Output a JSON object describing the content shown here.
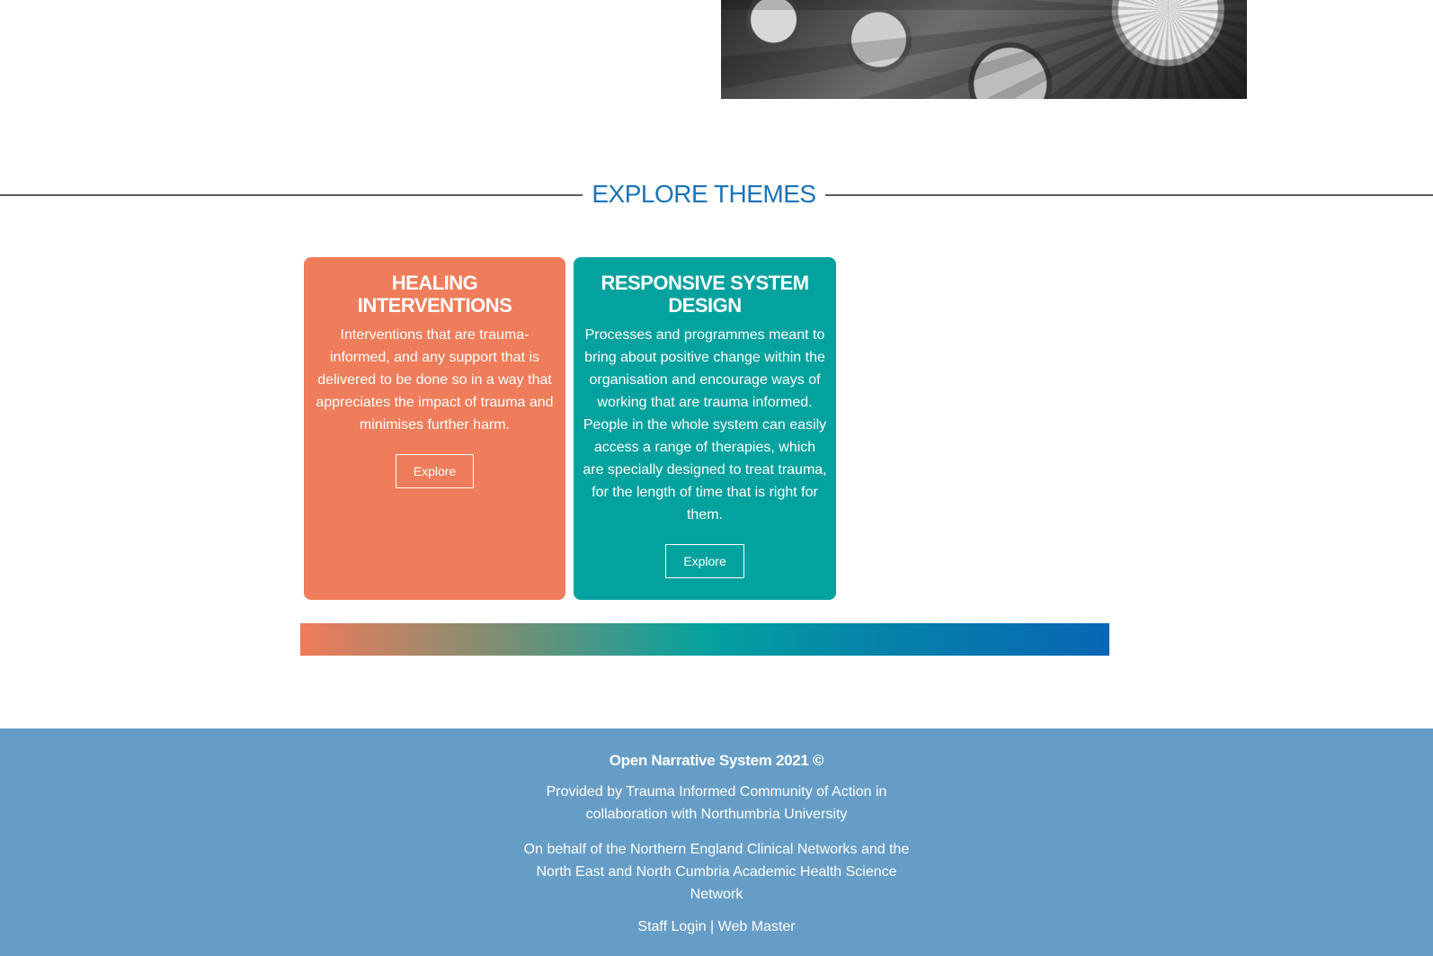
{
  "hero": {
    "image_alt": "gears"
  },
  "explore_section": {
    "title": "EXPLORE THEMES"
  },
  "themes": [
    {
      "title": "HEALING INTERVENTIONS",
      "description": "Interventions that are trauma-informed, and any support that is delivered to be done so in a way that appreciates the impact of trauma and minimises further harm.",
      "button_label": "Explore",
      "color": "#ef7c5a"
    },
    {
      "title": "RESPONSIVE SYSTEM DESIGN",
      "description": "Processes and programmes meant to bring about positive change within the organisation and encourage ways of working that are trauma informed. People in the whole system can easily access a range of therapies, which are specially designed to treat trauma, for the length of time that is right for them.",
      "button_label": "Explore",
      "color": "#04a29f"
    }
  ],
  "decor": {
    "gradient_colors": [
      "#ef7c5a",
      "#04a29f",
      "#0866b4"
    ]
  },
  "footer": {
    "title": "Open Narrative System 2021 ©",
    "provided_by": "Provided by Trauma Informed Community of Action in collaboration with Northumbria University",
    "on_behalf": "On behalf of the Northern England Clinical Networks and the North East and North Cumbria Academic Health Science Network",
    "staff_login": "Staff Login",
    "separator": " | ",
    "web_master": "Web Master",
    "background": "#669dc6"
  }
}
